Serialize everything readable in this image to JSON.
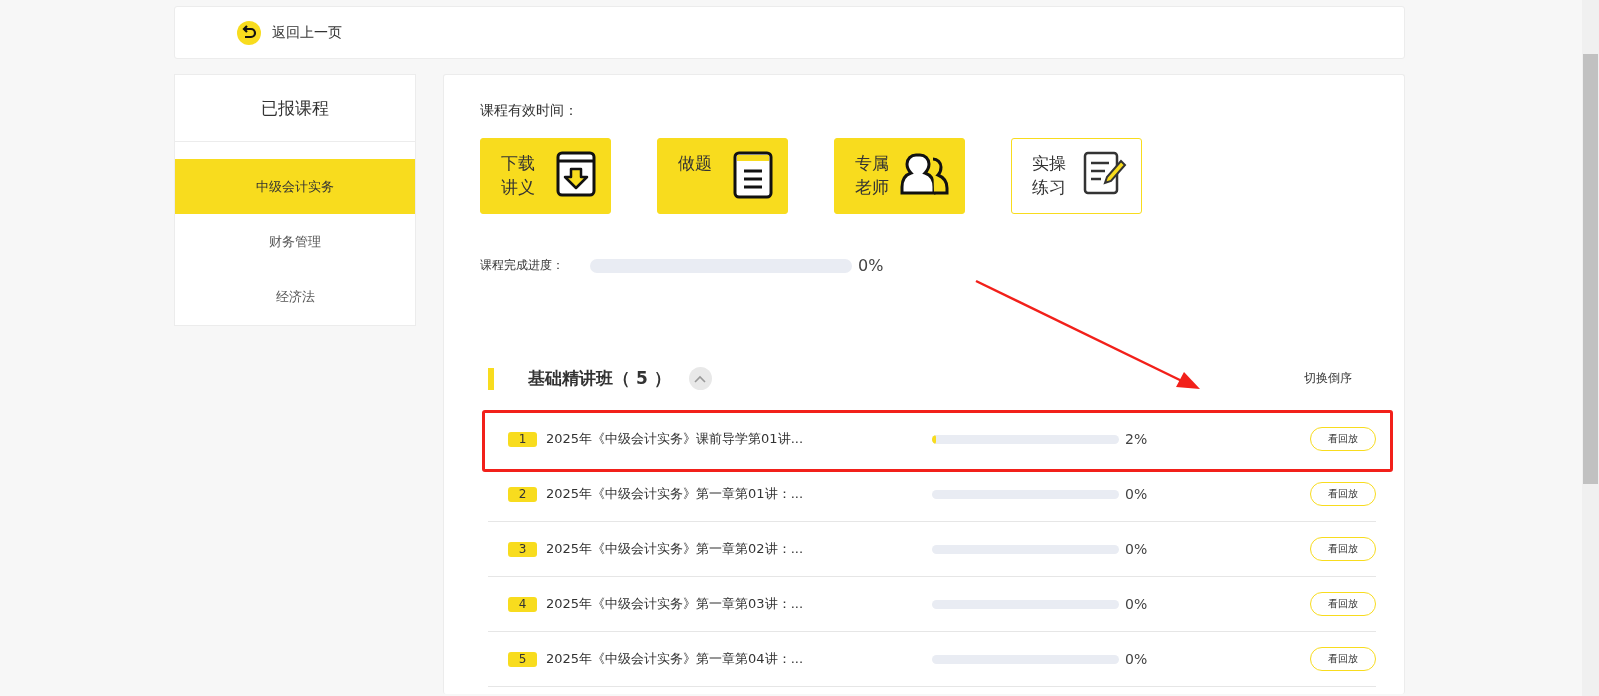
{
  "back_link": {
    "label": "返回上一页"
  },
  "sidebar": {
    "title": "已报课程",
    "items": [
      {
        "label": "中级会计实务",
        "selected": true
      },
      {
        "label": "财务管理",
        "selected": false
      },
      {
        "label": "经济法",
        "selected": false
      }
    ]
  },
  "course": {
    "validity_label": "课程有效时间：",
    "tools": [
      {
        "label": "下载讲义",
        "filled": true
      },
      {
        "label": "做题",
        "filled": true
      },
      {
        "label": "专属老师",
        "filled": true
      },
      {
        "label": "实操练习",
        "filled": false
      }
    ],
    "progress": {
      "label": "课程完成进度：",
      "level": 0,
      "reading": "0%"
    }
  },
  "section": {
    "title": "基础精讲班（ 5 ）",
    "expanded": true,
    "sort_toggle": "切换倒序",
    "lessons": [
      {
        "number": "1",
        "title": "2025年《中级会计实务》课前导学第01讲...",
        "level": 0.02,
        "reading": "2%",
        "action": "看回放",
        "highlighted": true
      },
      {
        "number": "2",
        "title": "2025年《中级会计实务》第一章第01讲：...",
        "level": 0,
        "reading": "0%",
        "action": "看回放",
        "highlighted": false
      },
      {
        "number": "3",
        "title": "2025年《中级会计实务》第一章第02讲：...",
        "level": 0,
        "reading": "0%",
        "action": "看回放",
        "highlighted": false
      },
      {
        "number": "4",
        "title": "2025年《中级会计实务》第一章第03讲：...",
        "level": 0,
        "reading": "0%",
        "action": "看回放",
        "highlighted": false
      },
      {
        "number": "5",
        "title": "2025年《中级会计实务》第一章第04讲：...",
        "level": 0,
        "reading": "0%",
        "action": "看回放",
        "highlighted": false
      }
    ]
  }
}
